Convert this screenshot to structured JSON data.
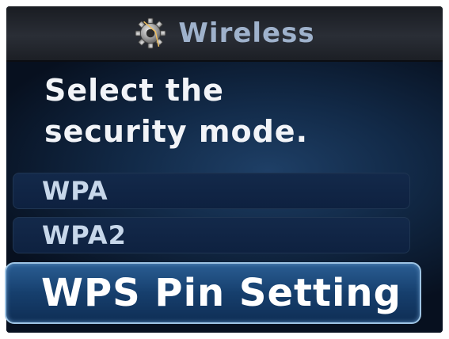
{
  "header": {
    "title": "Wireless",
    "icon": "gear-icon"
  },
  "prompt": "Select the\nsecurity mode.",
  "options": [
    {
      "label": "WPA",
      "selected": false
    },
    {
      "label": "WPA2",
      "selected": false
    },
    {
      "label": "WPS Pin Setting",
      "selected": true
    }
  ],
  "colors": {
    "accent": "#9ec4e4",
    "background": "#122a48"
  }
}
